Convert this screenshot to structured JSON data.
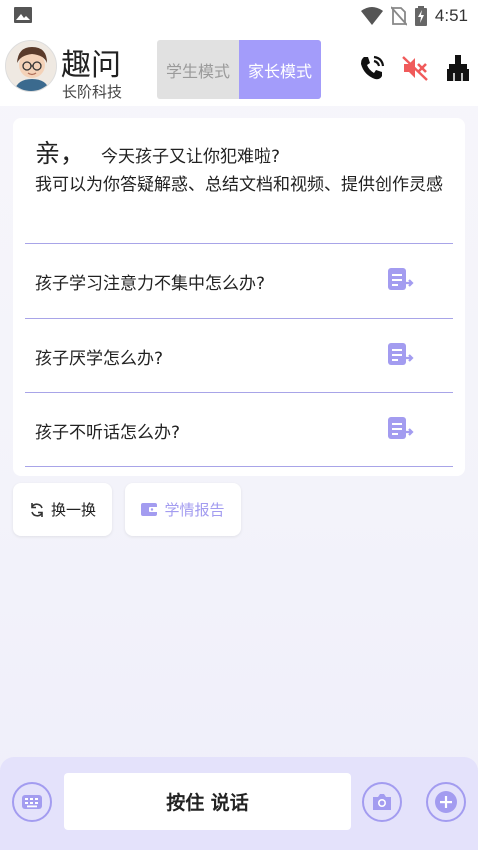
{
  "status_bar": {
    "time": "4:51",
    "icons": [
      "image-icon",
      "wifi-icon",
      "no-sim-icon",
      "battery-charging-icon"
    ]
  },
  "header": {
    "title": "趣问",
    "subtitle": "长阶科技",
    "modes": [
      {
        "label": "学生模式",
        "active": false
      },
      {
        "label": "家长模式",
        "active": true
      }
    ],
    "icons": [
      "phone-call-icon",
      "speaker-muted-icon",
      "broom-icon"
    ]
  },
  "card": {
    "greeting": "亲，",
    "greeting_line": "今天孩子又让你犯难啦?",
    "intro": "我可以为你答疑解惑、总结文档和视频、提供创作灵感",
    "questions": [
      {
        "text": "孩子学习注意力不集中怎么办?"
      },
      {
        "text": "孩子厌学怎么办?"
      },
      {
        "text": "孩子不听话怎么办?"
      }
    ]
  },
  "actions": {
    "refresh_label": "换一换",
    "report_label": "学情报告"
  },
  "bottom": {
    "talk_label": "按住 说话"
  },
  "colors": {
    "accent": "#a39cfa",
    "divider": "#a8a4e8",
    "icon": "#a39cf0",
    "muted_red": "#f05a5a"
  }
}
